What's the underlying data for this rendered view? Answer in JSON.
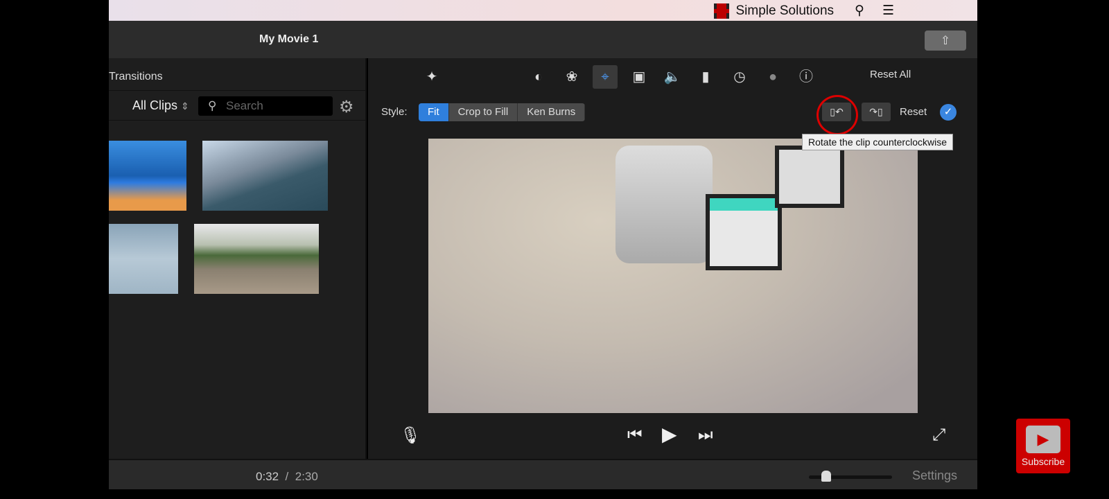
{
  "menubar": {
    "app_name": "Simple Solutions",
    "search_icon": "magnifier",
    "menu_icon": "list"
  },
  "titlebar": {
    "title": "My Movie 1",
    "share_icon": "share"
  },
  "browser": {
    "tab": "Transitions",
    "filter": "All Clips",
    "search_placeholder": "Search",
    "settings_icon": "gear"
  },
  "toolbar": {
    "tools": [
      "magic-wand",
      "color-balance",
      "color-correction",
      "crop",
      "stabilization",
      "volume",
      "equalizer",
      "speed",
      "clip-filter",
      "info"
    ],
    "selected": "crop",
    "reset_all": "Reset All"
  },
  "crop": {
    "style_label": "Style:",
    "styles": [
      "Fit",
      "Crop to Fill",
      "Ken Burns"
    ],
    "selected_style": "Fit",
    "reset": "Reset",
    "tooltip": "Rotate the clip counterclockwise"
  },
  "playback": {
    "current": "0:32",
    "separator": "/",
    "total": "2:30"
  },
  "bottom": {
    "settings": "Settings"
  },
  "overlay": {
    "subscribe": "Subscribe"
  },
  "colors": {
    "accent": "#2f7fdc",
    "highlight_ring": "#dd0000",
    "subscribe": "#cc0000"
  }
}
